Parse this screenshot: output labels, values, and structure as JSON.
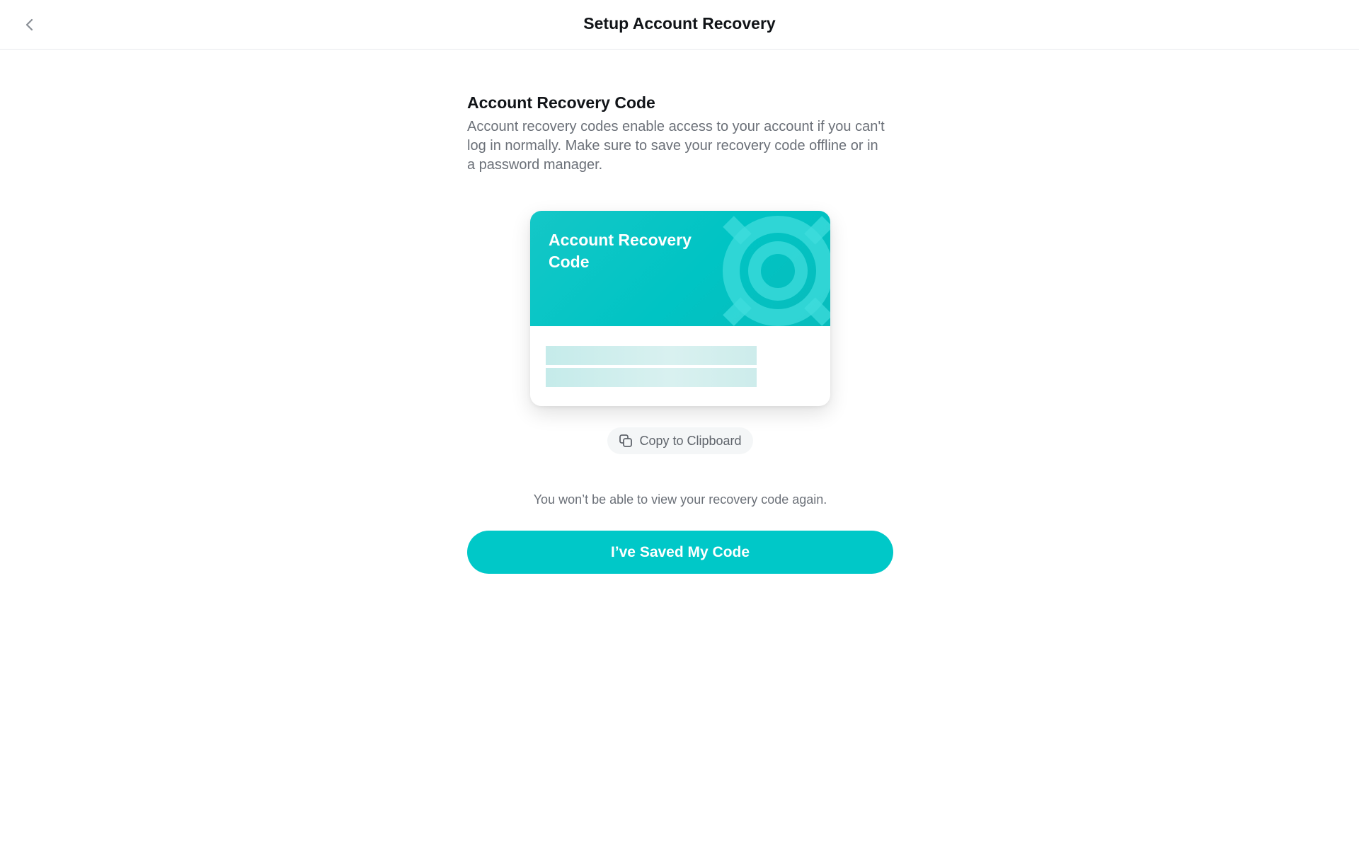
{
  "header": {
    "title": "Setup Account Recovery",
    "back_icon": "chevron-left-icon"
  },
  "main": {
    "heading": "Account Recovery Code",
    "description": "Account recovery codes enable access to your account if you can't log in normally. Make sure to save your recovery code offline or in a password manager.",
    "card": {
      "title": "Account Recovery Code",
      "logo_icon": "lifebuoy-icon",
      "accent_color": "#00c4c4"
    },
    "copy_button": {
      "label": "Copy to Clipboard",
      "icon": "copy-icon"
    },
    "warning": "You won’t be able to view your recovery code again.",
    "primary_button": {
      "label": "I’ve Saved My Code",
      "color": "#00c8c8"
    }
  }
}
